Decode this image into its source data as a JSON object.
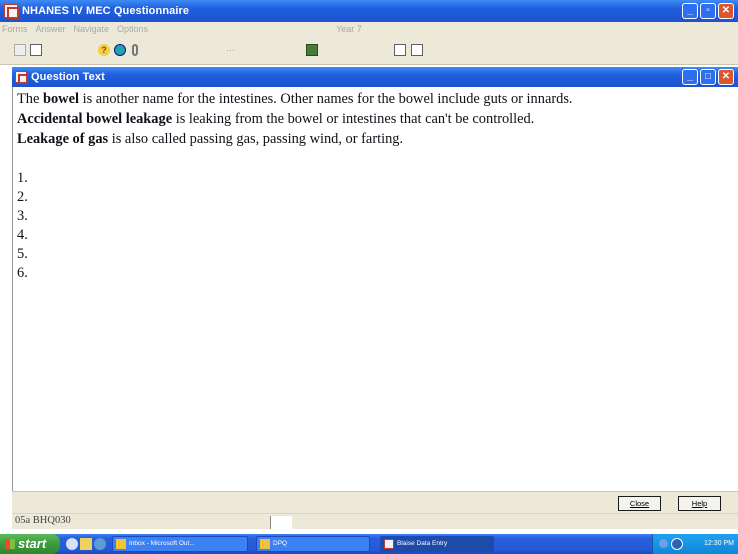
{
  "window": {
    "title": "NHANES IV MEC Questionnaire",
    "menu": [
      "Forms",
      "Answer",
      "Navigate",
      "Options"
    ],
    "year_label": "Year 7"
  },
  "toolbar": {
    "icons": [
      "copy-icon",
      "field-icon",
      "help-icon",
      "info-icon",
      "attach-icon",
      "more-icon",
      "book-icon",
      "prev-icon",
      "next-icon"
    ]
  },
  "question_window": {
    "title": "Question Text",
    "lines": [
      {
        "bold": "The ",
        "term": "bowel",
        "rest": " is another name for the intestines. Other names for the bowel include guts or innards."
      },
      {
        "term": "Accidental bowel leakage",
        "rest": " is leaking from the bowel or intestines that can't be controlled."
      },
      {
        "term": "Leakage of gas",
        "rest": " is also called passing gas, passing wind, or farting."
      }
    ],
    "numbers": [
      "1.",
      "2.",
      "3.",
      "4.",
      "5.",
      "6."
    ]
  },
  "buttons": {
    "close": "Close",
    "help": "Help"
  },
  "statusbar": {
    "text": "05a BHQ030"
  },
  "taskbar": {
    "start": "start",
    "tasks": [
      {
        "label": "Inbox - Microsoft Out..."
      },
      {
        "label": "DPQ"
      },
      {
        "label": "Blaise Data Entry"
      }
    ],
    "clock": "12:30 PM"
  },
  "colors": {
    "title_blue": "#1f5ede",
    "chrome": "#ece9d8",
    "close_red": "#d9562f",
    "start_green": "#3c9a3c"
  }
}
